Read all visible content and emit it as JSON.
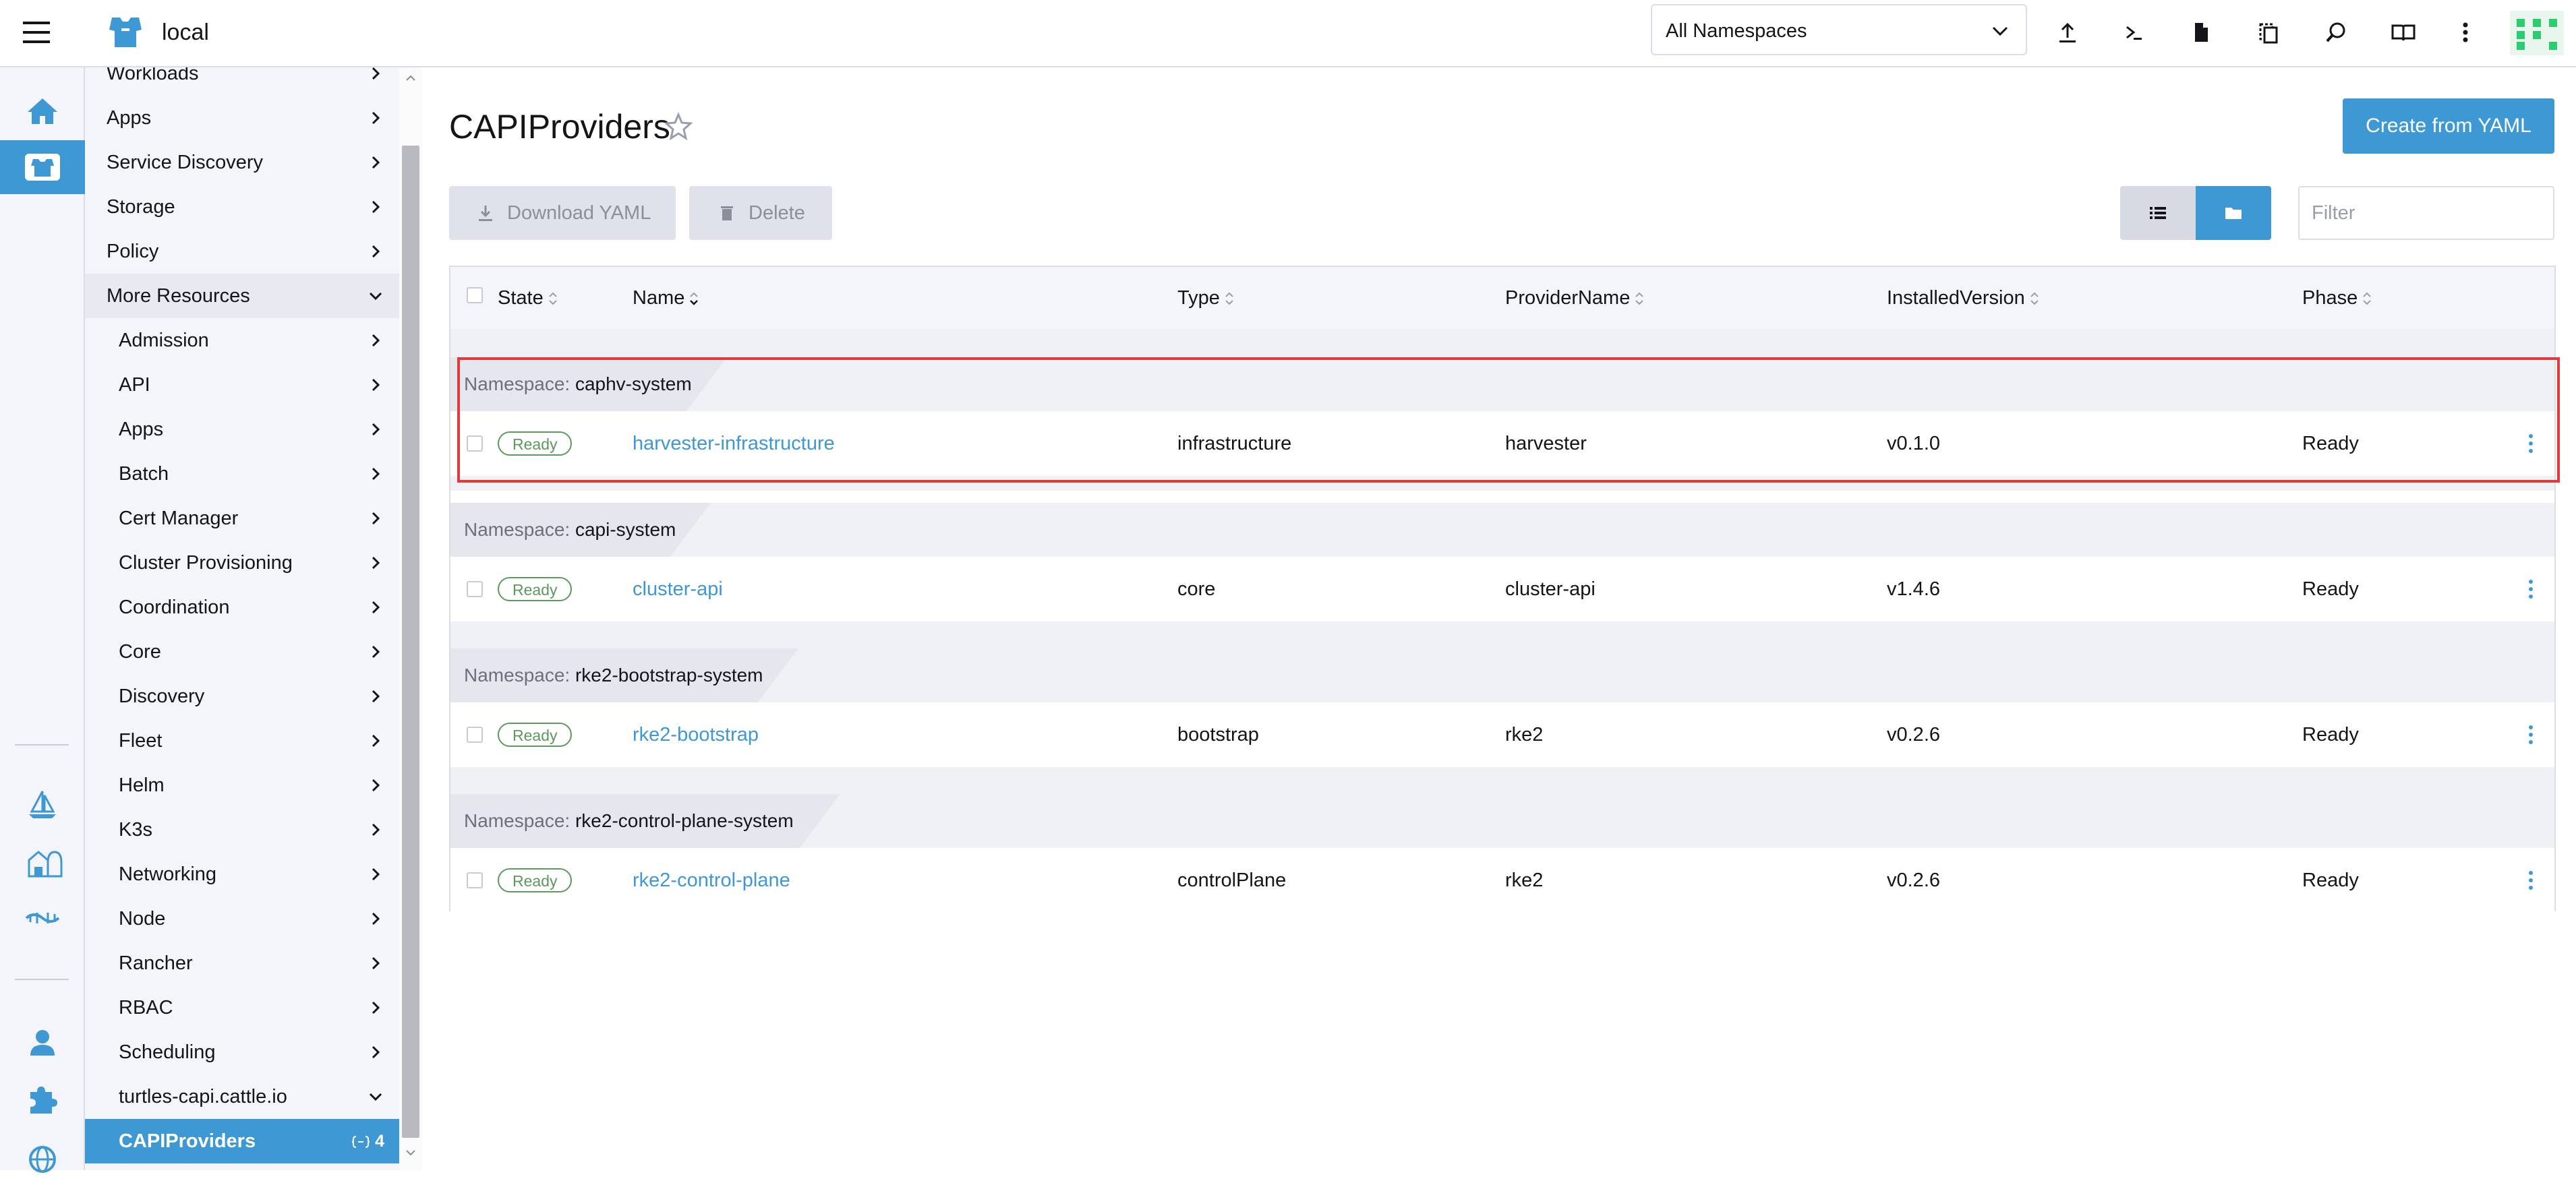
{
  "header": {
    "cluster_name": "local",
    "namespace_filter": "All Namespaces",
    "actions": [
      "import-yaml",
      "kubectl-shell",
      "kubeconfig-download",
      "copy-kubeconfig",
      "resource-search",
      "docs"
    ]
  },
  "rail": {
    "items": [
      "home",
      "cluster-explorer",
      "fleet",
      "cluster-management",
      "virtualization",
      "users",
      "extensions",
      "global-settings"
    ]
  },
  "sidebar": {
    "items": [
      {
        "label": "Workloads"
      },
      {
        "label": "Apps"
      },
      {
        "label": "Service Discovery"
      },
      {
        "label": "Storage"
      },
      {
        "label": "Policy"
      },
      {
        "label": "More Resources"
      },
      {
        "label": "Admission"
      },
      {
        "label": "API"
      },
      {
        "label": "Apps"
      },
      {
        "label": "Batch"
      },
      {
        "label": "Cert Manager"
      },
      {
        "label": "Cluster Provisioning"
      },
      {
        "label": "Coordination"
      },
      {
        "label": "Core"
      },
      {
        "label": "Discovery"
      },
      {
        "label": "Fleet"
      },
      {
        "label": "Helm"
      },
      {
        "label": "K3s"
      },
      {
        "label": "Networking"
      },
      {
        "label": "Node"
      },
      {
        "label": "Rancher"
      },
      {
        "label": "RBAC"
      },
      {
        "label": "Scheduling"
      },
      {
        "label": "turtles-capi.cattle.io"
      },
      {
        "label": "CAPIProviders",
        "count": "4"
      }
    ]
  },
  "page": {
    "title": "CAPIProviders",
    "create_button": "Create from YAML",
    "download_yaml": "Download YAML",
    "delete": "Delete",
    "filter_placeholder": "Filter"
  },
  "table": {
    "columns": [
      "State",
      "Name",
      "Type",
      "ProviderName",
      "InstalledVersion",
      "Phase"
    ],
    "namespace_prefix": "Namespace:",
    "groups": [
      {
        "namespace": "caphv-system",
        "rows": [
          {
            "state": "Ready",
            "name": "harvester-infrastructure",
            "type": "infrastructure",
            "provider": "harvester",
            "version": "v0.1.0",
            "phase": "Ready"
          }
        ]
      },
      {
        "namespace": "capi-system",
        "rows": [
          {
            "state": "Ready",
            "name": "cluster-api",
            "type": "core",
            "provider": "cluster-api",
            "version": "v1.4.6",
            "phase": "Ready"
          }
        ]
      },
      {
        "namespace": "rke2-bootstrap-system",
        "rows": [
          {
            "state": "Ready",
            "name": "rke2-bootstrap",
            "type": "bootstrap",
            "provider": "rke2",
            "version": "v0.2.6",
            "phase": "Ready"
          }
        ]
      },
      {
        "namespace": "rke2-control-plane-system",
        "rows": [
          {
            "state": "Ready",
            "name": "rke2-control-plane",
            "type": "controlPlane",
            "provider": "rke2",
            "version": "v0.2.6",
            "phase": "Ready"
          }
        ]
      }
    ]
  },
  "colors": {
    "accent": "#3d98d3",
    "success": "#5d995d",
    "highlight": "#e23a3a"
  }
}
